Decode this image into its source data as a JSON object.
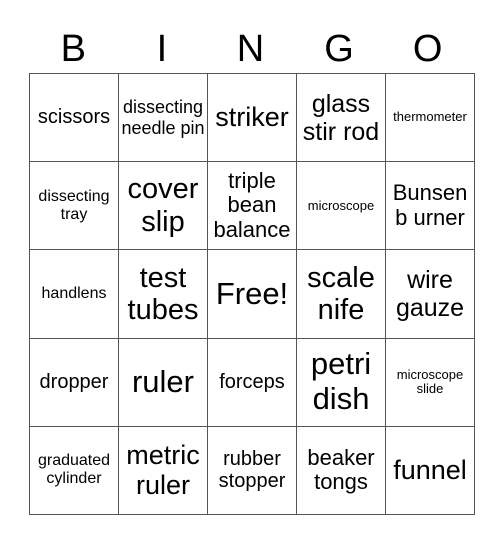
{
  "header": [
    "B",
    "I",
    "N",
    "G",
    "O"
  ],
  "rows": [
    [
      "scissors",
      "dissecting needle pin",
      "striker",
      "glass stir rod",
      "thermometer"
    ],
    [
      "dissecting tray",
      "cover slip",
      "triple bean balance",
      "microscope",
      "Bunsen b urner"
    ],
    [
      "handlens",
      "test tubes",
      "Free!",
      "scale nife",
      "wire gauze"
    ],
    [
      "dropper",
      "ruler",
      "forceps",
      "petri dish",
      "microscope slide"
    ],
    [
      "graduated cylinder",
      "metric ruler",
      "rubber stopper",
      "beaker tongs",
      "funnel"
    ]
  ]
}
